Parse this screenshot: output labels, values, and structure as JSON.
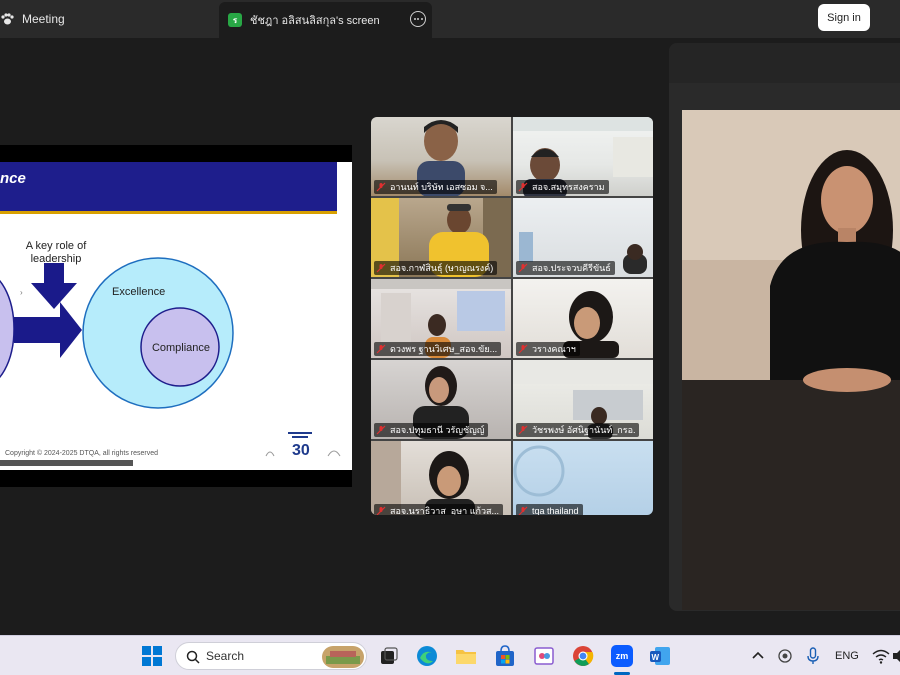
{
  "window": {
    "meeting_label": "Meeting",
    "screen_tab_badge": "ร",
    "screen_tab_label": "ชัชฎา  อลิสนลิสกุล's screen",
    "sign_in_label": "Sign in"
  },
  "slide": {
    "title": "nce",
    "key_role": "A  key role of leadership",
    "excellence": "Excellence",
    "compliance": "Compliance",
    "copyright": "Copyright © 2024-2025 DTQA, all rights reserved",
    "logo_number": "30"
  },
  "participants": [
    {
      "name": "อานนท์ บริษัท เอสซอม จ..."
    },
    {
      "name": "สอจ.สมุทรสงคราม"
    },
    {
      "name": "สอจ.กาฬสินธุ์ (ษาญณรงค์)"
    },
    {
      "name": "สอจ.ประจวบคีรีขันธ์"
    },
    {
      "name": "ดวงพร ฐานวิเศษ_สอจ.ขัย..."
    },
    {
      "name": "วรางคณาฯ"
    },
    {
      "name": "สอจ.ปทุมธานี วรัญชัญญ์"
    },
    {
      "name": "วัชรพงษ์ อัศนิฐานันท์_กรอ."
    },
    {
      "name": "สอจ.นราธิวาส_อุษา แก้วส..."
    },
    {
      "name": "tqa thailand"
    }
  ],
  "taskbar": {
    "search_label": "Search",
    "language": "ENG",
    "zoom_icon_text": "zm"
  },
  "colors": {
    "slide_header": "#1e1e8c",
    "arrow": "#1a1a8a",
    "outer_circle": "#b6ecfb",
    "inner_circle": "#c8c0ee",
    "accent_blue": "#0067c0"
  }
}
